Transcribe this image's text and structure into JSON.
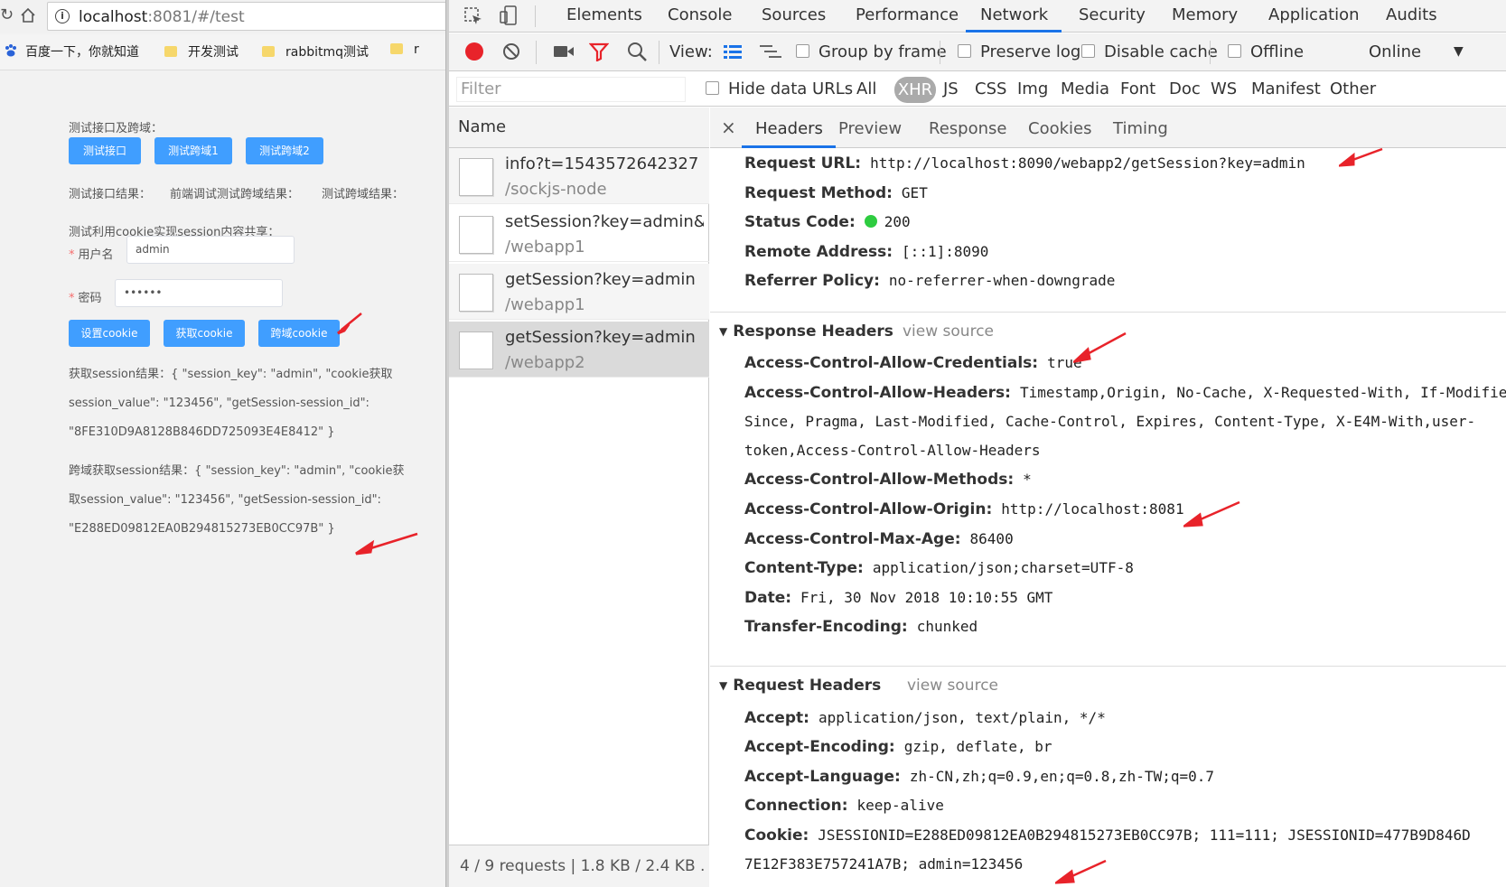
{
  "browser": {
    "url_host": "localhost",
    "url_rest": ":8081/#/test",
    "bookmarks": [
      "百度一下，你就知道",
      "开发测试",
      "rabbitmq测试",
      "r"
    ]
  },
  "page": {
    "section1_label": "测试接口及跨域：",
    "btn_test_api": "测试接口",
    "btn_test_cors1": "测试跨域1",
    "btn_test_cors2": "测试跨域2",
    "result_labels": [
      "测试接口结果：",
      "前端调试测试跨域结果：",
      "测试跨域结果："
    ],
    "section2_label": "测试利用cookie实现session内容共享：",
    "username_label": "用户名",
    "username_value": "admin",
    "password_label": "密码",
    "password_value": "••••••",
    "btn_set_cookie": "设置cookie",
    "btn_get_cookie": "获取cookie",
    "btn_cors_cookie": "跨域cookie",
    "session_result_lines": [
      "获取session结果：{ \"session_key\": \"admin\", \"cookie获取",
      "session_value\": \"123456\", \"getSession-session_id\":",
      "\"8FE310D9A8128B846DD725093E4E8412\" }"
    ],
    "cors_session_result_lines": [
      "跨域获取session结果：{ \"session_key\": \"admin\", \"cookie获",
      "取session_value\": \"123456\", \"getSession-session_id\":",
      "\"E288ED09812EA0B294815273EB0CC97B\" }"
    ]
  },
  "devtools": {
    "tabs": [
      "Elements",
      "Console",
      "Sources",
      "Performance",
      "Network",
      "Security",
      "Memory",
      "Application",
      "Audits"
    ],
    "active_tab": "Network",
    "toolbar": {
      "view_label": "View:",
      "group_by_frame": "Group by frame",
      "preserve_log": "Preserve log",
      "disable_cache": "Disable cache",
      "offline": "Offline",
      "online": "Online"
    },
    "filter": {
      "placeholder": "Filter",
      "hide_data_urls": "Hide data URLs",
      "types": [
        "All",
        "XHR",
        "JS",
        "CSS",
        "Img",
        "Media",
        "Font",
        "Doc",
        "WS",
        "Manifest",
        "Other"
      ],
      "active_type": "XHR"
    },
    "name_header": "Name",
    "requests": [
      {
        "name": "info?t=1543572642327",
        "path": "/sockjs-node"
      },
      {
        "name": "setSession?key=admin&...",
        "path": "/webapp1"
      },
      {
        "name": "getSession?key=admin",
        "path": "/webapp1"
      },
      {
        "name": "getSession?key=admin",
        "path": "/webapp2"
      }
    ],
    "status": "4 / 9 requests  |  1.8 KB / 2.4 KB ...",
    "detail_tabs": [
      "×",
      "Headers",
      "Preview",
      "Response",
      "Cookies",
      "Timing"
    ],
    "general": [
      {
        "k": "Request URL:",
        "v": "http://localhost:8090/webapp2/getSession?key=admin"
      },
      {
        "k": "Request Method:",
        "v": "GET"
      },
      {
        "k": "Status Code:",
        "v": "200"
      },
      {
        "k": "Remote Address:",
        "v": "[::1]:8090"
      },
      {
        "k": "Referrer Policy:",
        "v": "no-referrer-when-downgrade"
      }
    ],
    "response_headers_title": "Response Headers",
    "view_source": "view source",
    "response_headers": [
      {
        "k": "Access-Control-Allow-Credentials:",
        "v": "true"
      },
      {
        "k": "Access-Control-Allow-Headers:",
        "v": "Timestamp,Origin, No-Cache, X-Requested-With, If-Modified-"
      },
      {
        "k": "",
        "v": "Since, Pragma, Last-Modified, Cache-Control, Expires, Content-Type, X-E4M-With,user-"
      },
      {
        "k": "",
        "v": "token,Access-Control-Allow-Headers"
      },
      {
        "k": "Access-Control-Allow-Methods:",
        "v": "*"
      },
      {
        "k": "Access-Control-Allow-Origin:",
        "v": "http://localhost:8081"
      },
      {
        "k": "Access-Control-Max-Age:",
        "v": "86400"
      },
      {
        "k": "Content-Type:",
        "v": "application/json;charset=UTF-8"
      },
      {
        "k": "Date:",
        "v": "Fri, 30 Nov 2018 10:10:55 GMT"
      },
      {
        "k": "Transfer-Encoding:",
        "v": "chunked"
      }
    ],
    "request_headers_title": "Request Headers",
    "request_headers": [
      {
        "k": "Accept:",
        "v": "application/json, text/plain, */*"
      },
      {
        "k": "Accept-Encoding:",
        "v": "gzip, deflate, br"
      },
      {
        "k": "Accept-Language:",
        "v": "zh-CN,zh;q=0.9,en;q=0.8,zh-TW;q=0.7"
      },
      {
        "k": "Connection:",
        "v": "keep-alive"
      },
      {
        "k": "Cookie:",
        "v": "JSESSIONID=E288ED09812EA0B294815273EB0CC97B; 111=111; JSESSIONID=477B9D846D"
      },
      {
        "k": "",
        "v": "7E12F383E757241A7B; admin=123456"
      }
    ]
  },
  "colors": {
    "primary_button": "#409eff",
    "active_tab_underline": "#1a73e8",
    "annotation_arrow": "#e8232a",
    "status_ok": "#2ecc40"
  }
}
